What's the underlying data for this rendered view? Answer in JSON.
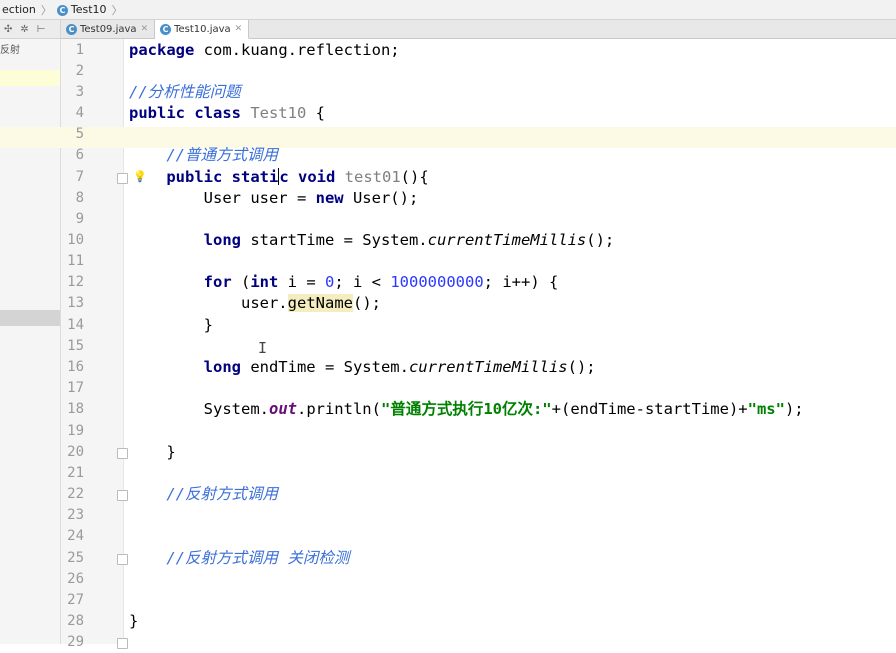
{
  "breadcrumb": {
    "items": [
      "ection",
      "Test10"
    ]
  },
  "toolbar": {
    "icons": [
      "sync-icon",
      "gear-icon",
      "collapse-icon"
    ]
  },
  "tabs": [
    {
      "label": "Test09.java",
      "active": false
    },
    {
      "label": "Test10.java",
      "active": true
    }
  ],
  "project_panel": {
    "item_label": "反射"
  },
  "editor": {
    "line_numbers": [
      "1",
      "2",
      "3",
      "4",
      "5",
      "6",
      "7",
      "8",
      "9",
      "10",
      "11",
      "12",
      "13",
      "14",
      "15",
      "16",
      "17",
      "18",
      "19",
      "20",
      "21",
      "22",
      "23",
      "24",
      "25",
      "26",
      "27",
      "28",
      "29"
    ],
    "current_line": 7,
    "code": {
      "l1_kw": "package",
      "l1_rest": " com.kuang.reflection;",
      "l3_comment": "//分析性能问题",
      "l4_kw": "public class",
      "l4_name": " Test10",
      "l4_rest": " {",
      "l6_comment": "//普通方式调用",
      "l7_kw1": "public stati",
      "l7_kw1b": "c",
      "l7_kw2": " void",
      "l7_name": " test01",
      "l7_rest": "(){",
      "l8_a": "User user = ",
      "l8_kw": "new",
      "l8_b": " User();",
      "l10_kw": "long",
      "l10_a": " startTime = System.",
      "l10_method": "currentTimeMillis",
      "l10_b": "();",
      "l12_kw1": "for",
      "l12_a": " (",
      "l12_kw2": "int",
      "l12_b": " i = ",
      "l12_n1": "0",
      "l12_c": "; i < ",
      "l12_n2": "1000000000",
      "l12_d": "; i++) {",
      "l13_a": "user.",
      "l13_method": "getName",
      "l13_b": "();",
      "l14": "}",
      "l16_kw": "long",
      "l16_a": " endTime = System.",
      "l16_method": "currentTimeMillis",
      "l16_b": "();",
      "l18_a": "System.",
      "l18_field": "out",
      "l18_b": ".println(",
      "l18_str1": "\"普通方式执行10亿次:\"",
      "l18_c": "+(endTime-startTime)+",
      "l18_str2": "\"ms\"",
      "l18_d": ");",
      "l20": "}",
      "l22_comment": "//反射方式调用",
      "l25_comment": "//反射方式调用 关闭检测",
      "l28": "}"
    }
  }
}
